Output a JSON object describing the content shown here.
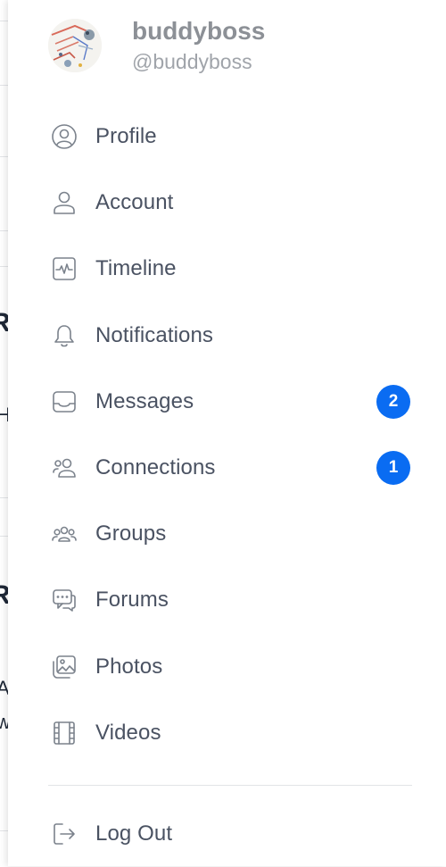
{
  "user": {
    "name": "buddyboss",
    "handle": "@buddyboss"
  },
  "menu": [
    {
      "label": "Profile",
      "icon": "user-circle-icon"
    },
    {
      "label": "Account",
      "icon": "user-icon"
    },
    {
      "label": "Timeline",
      "icon": "activity-icon"
    },
    {
      "label": "Notifications",
      "icon": "bell-icon"
    },
    {
      "label": "Messages",
      "icon": "inbox-icon",
      "badge": "2"
    },
    {
      "label": "Connections",
      "icon": "users-icon",
      "badge": "1"
    },
    {
      "label": "Groups",
      "icon": "groups-icon"
    },
    {
      "label": "Forums",
      "icon": "chat-icon"
    },
    {
      "label": "Photos",
      "icon": "images-icon"
    },
    {
      "label": "Videos",
      "icon": "film-icon"
    }
  ],
  "logout": {
    "label": "Log Out",
    "icon": "log-out-icon"
  },
  "colors": {
    "badge": "#0a6cf2",
    "text": "#4a5262",
    "icon": "#7b828c"
  }
}
